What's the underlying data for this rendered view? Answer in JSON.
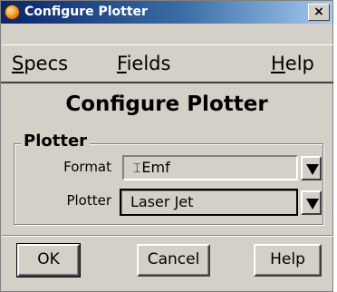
{
  "window": {
    "title": "Configure Plotter",
    "close_glyph": "×"
  },
  "menu": {
    "specs": {
      "mnemonic": "S",
      "rest": "pecs"
    },
    "fields": {
      "mnemonic": "F",
      "rest": "ields"
    },
    "help": {
      "mnemonic": "H",
      "rest": "elp"
    }
  },
  "heading": "Configure Plotter",
  "group": {
    "label": "Plotter",
    "format": {
      "label": "Format",
      "value": "Emf"
    },
    "plotter": {
      "label": "Plotter",
      "value": "Laser Jet"
    }
  },
  "buttons": {
    "ok": "OK",
    "cancel": "Cancel",
    "help": "Help"
  },
  "icons": {
    "app": "plotter-app-icon",
    "close": "close-icon",
    "dropdown": "triangle-down-icon"
  }
}
